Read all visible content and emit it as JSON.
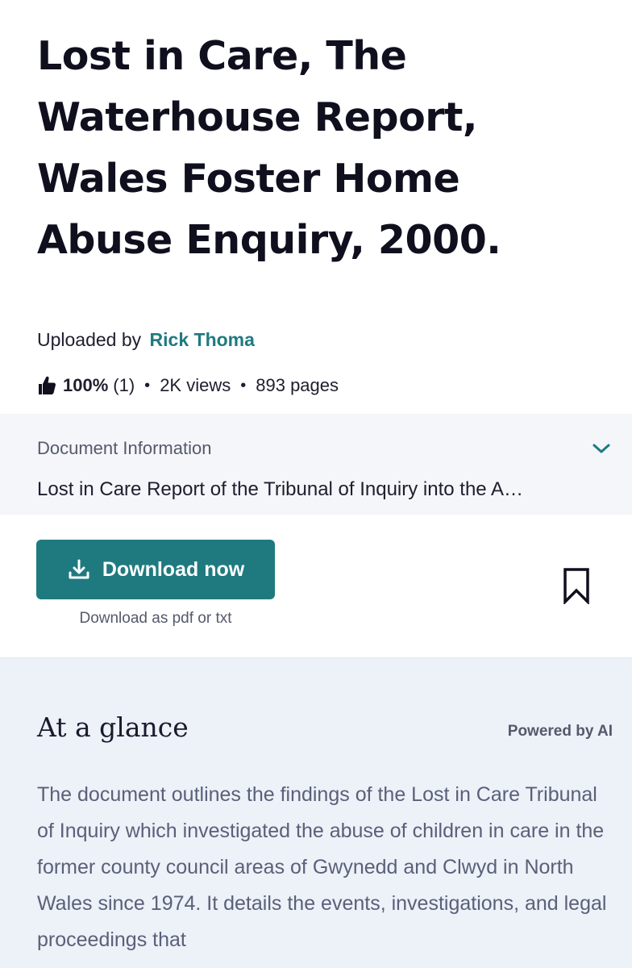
{
  "document": {
    "title": "Lost in Care, The Waterhouse Report, Wales Foster Home Abuse Enquiry, 2000.",
    "uploaded_by_label": "Uploaded by",
    "uploader_name": "Rick Thoma",
    "rating_percent": "100%",
    "rating_count": "(1)",
    "views": "2K views",
    "pages": "893 pages",
    "separator": "•"
  },
  "info": {
    "label": "Document Information",
    "description": "Lost in Care Report of the Tribunal of Inquiry into the A…",
    "chevron_icon": "chevron-down-icon"
  },
  "download": {
    "button_label": "Download now",
    "subtext": "Download as pdf or txt",
    "icon": "download-icon",
    "bookmark_icon": "bookmark-icon"
  },
  "glance": {
    "title": "At a glance",
    "powered_by": "Powered by AI",
    "summary": "The document outlines the findings of the Lost in Care Tribunal of Inquiry which investigated the abuse of children in care in the former county council areas of Gwynedd and Clwyd in North Wales since 1974. It details the events, investigations, and legal proceedings that"
  },
  "colors": {
    "accent": "#1f7a80",
    "info_band": "#f4f6fa",
    "glance_bg": "#edf1f8"
  }
}
